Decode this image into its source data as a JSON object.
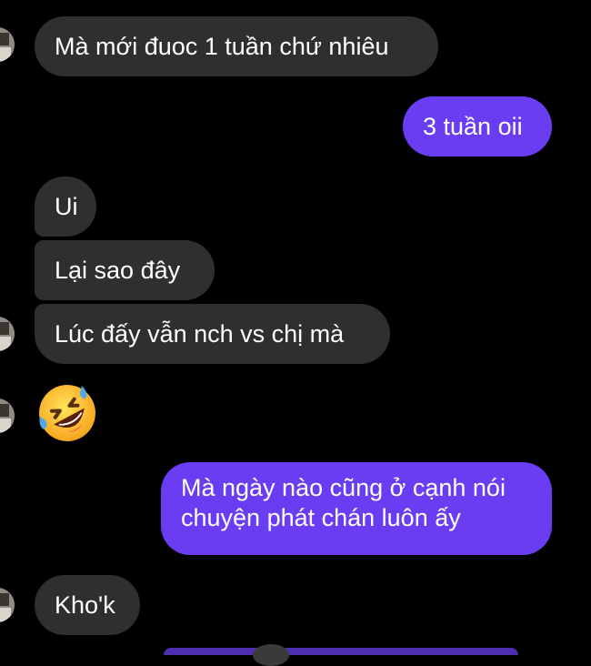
{
  "colors": {
    "background": "#000000",
    "incoming_bubble": "#2f2f31",
    "outgoing_bubble": "#6a3df2",
    "text": "#ffffff"
  },
  "messages": [
    {
      "sender": "other",
      "text": "Mà mới đuoc 1 tuần chứ nhiêu"
    },
    {
      "sender": "me",
      "text": "3 tuần oii"
    },
    {
      "sender": "other",
      "text": "Ui"
    },
    {
      "sender": "other",
      "text": "Lại sao đây"
    },
    {
      "sender": "other",
      "text": "Lúc đấy vẫn nch vs chị mà"
    },
    {
      "sender": "other",
      "icon": "rolling-on-floor-laughing-emoji"
    },
    {
      "sender": "me",
      "lines": [
        "Mà ngày nào cũng ở cạnh nói",
        "chuyện phát chán luôn ấy"
      ]
    },
    {
      "sender": "other",
      "text": "Kho'k"
    }
  ]
}
